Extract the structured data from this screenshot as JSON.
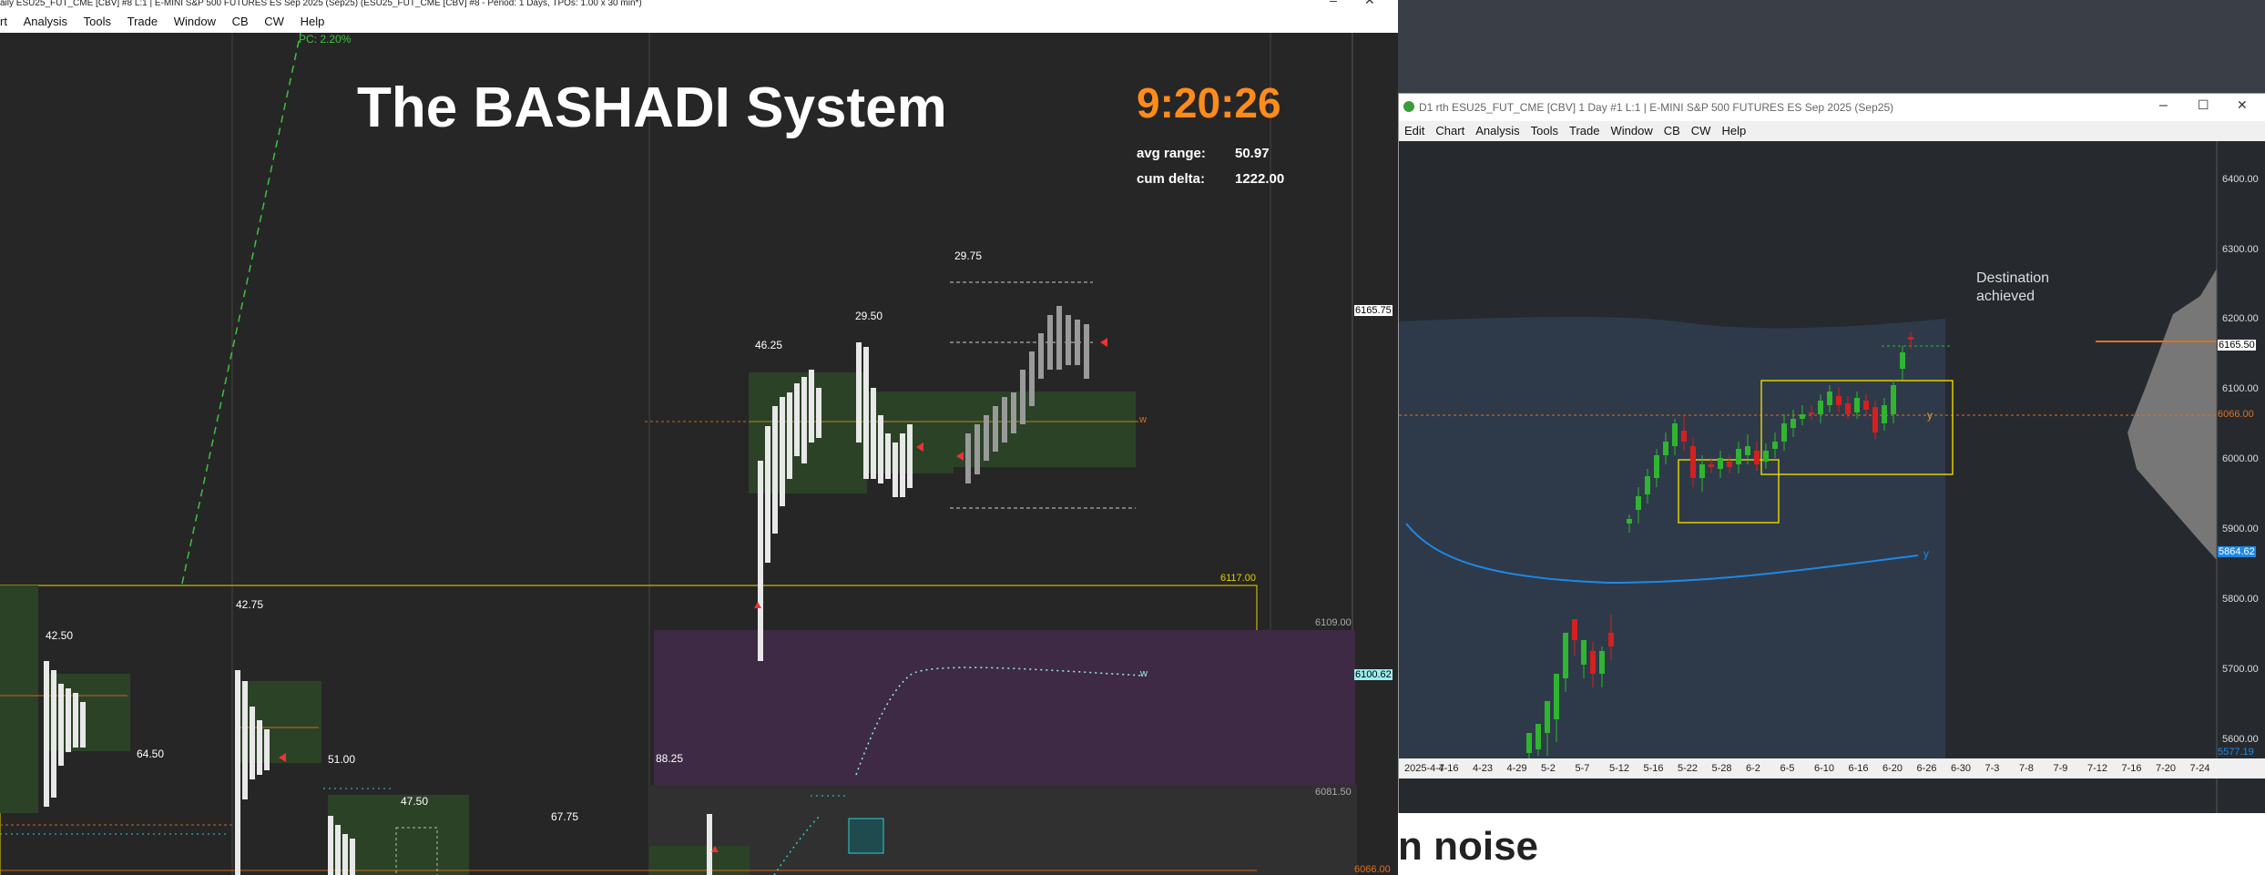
{
  "left_window": {
    "title": "aily ESU25_FUT_CME [CBV] #8 L:1 | E-MINI S&P 500 FUTURES ES Sep 2025 (Sep25) (ESU25_FUT_CME [CBV] #8 - Period: 1 Days, TPOs: 1.00 x 30 min*)",
    "menu": [
      "rt",
      "Analysis",
      "Tools",
      "Trade",
      "Window",
      "CB",
      "CW",
      "Help"
    ],
    "chart": {
      "heading": "The BASHADI System",
      "clock": "9:20:26",
      "avg_range_label": "avg range:",
      "avg_range_value": "50.97",
      "cum_delta_label": "cum delta:",
      "cum_delta_value": "1222.00",
      "pc_label": "PC: 2.20%",
      "range_labels": [
        "29.75",
        "29.50",
        "46.25",
        "42.50",
        "42.75",
        "64.50",
        "51.00",
        "47.50",
        "67.75",
        "88.25"
      ],
      "price_labels": {
        "p6165": "6165.75",
        "p6117": "6117.00",
        "p6109": "6109.00",
        "p6100": "6100.62",
        "p6081": "6081.50",
        "p6066": "6066.00"
      },
      "marker_w": "w"
    }
  },
  "right_window": {
    "title": "D1 rth ESU25_FUT_CME [CBV]  1 Day  #1 L:1 | E-MINI S&P 500 FUTURES ES Sep 2025 (Sep25)",
    "menu": [
      "Edit",
      "Chart",
      "Analysis",
      "Tools",
      "Trade",
      "Window",
      "CB",
      "CW",
      "Help"
    ],
    "annotation": [
      "Destination",
      "achieved"
    ],
    "y_marker": "y",
    "y_axis": [
      "6400.00",
      "6300.00",
      "6200.00",
      "6100.00",
      "6000.00",
      "5900.00",
      "5800.00",
      "5700.00",
      "5600.00"
    ],
    "price_tags": {
      "last": "6165.50",
      "poc": "6066.00",
      "ma": "5864.62",
      "low": "5577.19"
    },
    "x_axis": [
      "2025-4-7",
      "4-16",
      "4-23",
      "4-29",
      "5-2",
      "5-7",
      "5-12",
      "5-16",
      "5-22",
      "5-28",
      "6-2",
      "6-5",
      "6-10",
      "6-16",
      "6-20",
      "6-26",
      "6-30",
      "7-3",
      "7-8",
      "7-9",
      "7-12",
      "7-16",
      "7-20",
      "7-24"
    ]
  },
  "background_text": "n noise",
  "colors": {
    "up": "#2fb52f",
    "down": "#d42020",
    "clock": "#ff8c1a",
    "ma": "#1e88e5",
    "box": "#e0d000",
    "poc": "#e07020"
  }
}
